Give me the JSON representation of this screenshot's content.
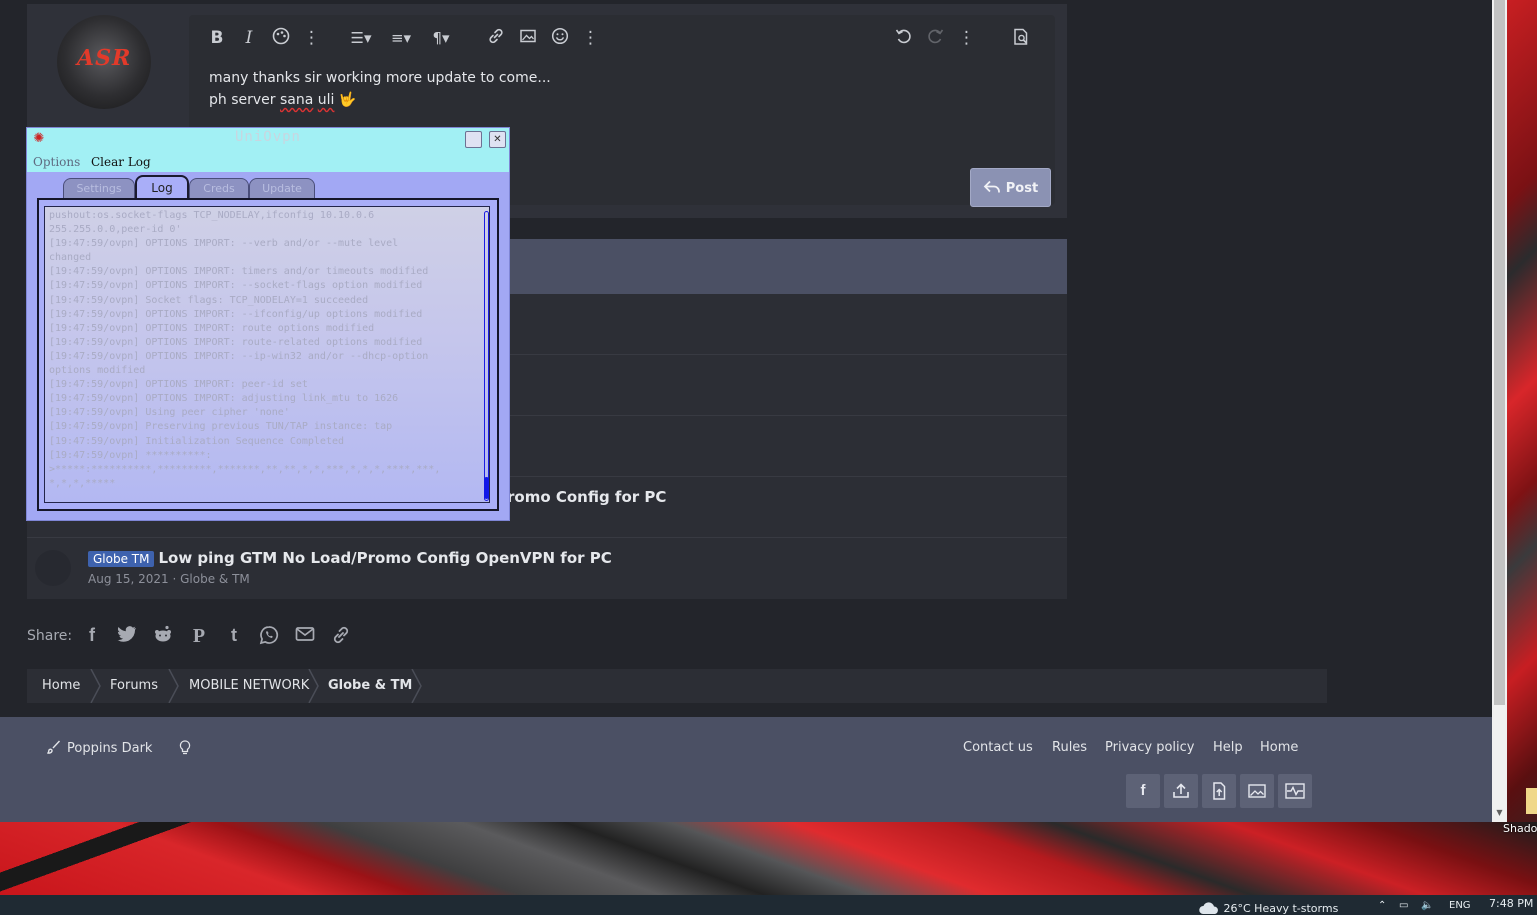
{
  "editor": {
    "line1": "many thanks sir working more update to come...",
    "line2_prefix": "ph server ",
    "line2_misspelled1": "sana",
    "line2_space": " ",
    "line2_misspelled2": "uli",
    "line2_emoji": "🤟",
    "avatar_text": "ASR",
    "toolbar_icons": [
      "bold-icon",
      "italic-icon",
      "palette-icon",
      "more-vertical-icon",
      "list-icon",
      "align-icon",
      "paragraph-icon",
      "link-icon",
      "image-icon",
      "smiley-icon",
      "more-vertical-icon",
      "undo-icon",
      "redo-icon",
      "more-vertical-icon",
      "preview-icon"
    ],
    "bold": "B",
    "italic": "I",
    "post_label": "Post"
  },
  "similar_threads": [
    {
      "prefix": "",
      "title": "romo Config for PC",
      "meta": ""
    },
    {
      "prefix": "Globe TM",
      "title": "Low ping GTM No Load/Promo Config OpenVPN for PC",
      "meta": "Aug 15, 2021 · Globe & TM"
    }
  ],
  "share": {
    "label": "Share:",
    "icons": [
      "facebook-icon",
      "twitter-icon",
      "reddit-icon",
      "pinterest-icon",
      "tumblr-icon",
      "whatsapp-icon",
      "email-icon",
      "link-icon"
    ]
  },
  "breadcrumb": [
    "Home",
    "Forums",
    "MOBILE NETWORK",
    "Globe & TM"
  ],
  "footer": {
    "style_name": "Poppins Dark",
    "links": [
      "Contact us",
      "Rules",
      "Privacy policy",
      "Help",
      "Home"
    ],
    "buttons": [
      "facebook-icon",
      "upload-icon",
      "file-upload-icon",
      "image-icon",
      "chart-icon"
    ]
  },
  "uniovpn": {
    "title": "UniOvpn",
    "menu": [
      "Options",
      "Clear Log"
    ],
    "tabs": [
      "Settings",
      "Log",
      "Creds",
      "Update"
    ],
    "active_tab": "Log",
    "log": "pushout:os.socket-flags TCP_NODELAY,ifconfig 10.10.0.6\n255.255.0.0,peer-id 0'\n[19:47:59/ovpn] OPTIONS IMPORT: --verb and/or --mute level\nchanged\n[19:47:59/ovpn] OPTIONS IMPORT: timers and/or timeouts modified\n[19:47:59/ovpn] OPTIONS IMPORT: --socket-flags option modified\n[19:47:59/ovpn] Socket flags: TCP_NODELAY=1 succeeded\n[19:47:59/ovpn] OPTIONS IMPORT: --ifconfig/up options modified\n[19:47:59/ovpn] OPTIONS IMPORT: route options modified\n[19:47:59/ovpn] OPTIONS IMPORT: route-related options modified\n[19:47:59/ovpn] OPTIONS IMPORT: --ip-win32 and/or --dhcp-option\noptions modified\n[19:47:59/ovpn] OPTIONS IMPORT: peer-id set\n[19:47:59/ovpn] OPTIONS IMPORT: adjusting link_mtu to 1626\n[19:47:59/ovpn] Using peer cipher 'none'\n[19:47:59/ovpn] Preserving previous TUN/TAP instance: tap\n[19:47:59/ovpn] Initialization Sequence Completed\n[19:47:59/ovpn] **********:\n>*****:**********,*********,*******,**,**,*,*,***,*,*,*,****,***,\n*,*,*,*****"
  },
  "desktop": {
    "icon_label": "Shado"
  },
  "taskbar": {
    "weather": "26°C  Heavy t-storms",
    "lang": "ENG",
    "time": "7:48 PM"
  }
}
